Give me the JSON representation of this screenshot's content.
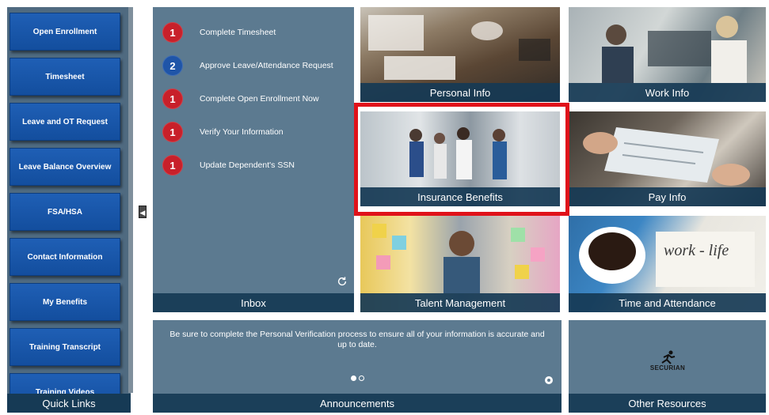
{
  "sidebar": {
    "items": [
      {
        "label": "Open Enrollment"
      },
      {
        "label": "Timesheet"
      },
      {
        "label": "Leave and OT Request"
      },
      {
        "label": "Leave Balance Overview"
      },
      {
        "label": "FSA/HSA"
      },
      {
        "label": "Contact Information"
      },
      {
        "label": "My Benefits"
      },
      {
        "label": "Training Transcript"
      },
      {
        "label": "Training Videos"
      }
    ],
    "footer": "Quick Links"
  },
  "inbox": {
    "items": [
      {
        "count": "1",
        "text": "Complete Timesheet",
        "color": "#c8202a"
      },
      {
        "count": "2",
        "text": "Approve Leave/Attendance Request",
        "color": "#1f55a8"
      },
      {
        "count": "1",
        "text": "Complete Open Enrollment Now",
        "color": "#c8202a"
      },
      {
        "count": "1",
        "text": "Verify Your Information",
        "color": "#c8202a"
      },
      {
        "count": "1",
        "text": "Update Dependent's SSN",
        "color": "#c8202a"
      }
    ],
    "label": "Inbox"
  },
  "tiles": {
    "personal": "Personal Info",
    "work": "Work Info",
    "insurance": "Insurance Benefits",
    "pay": "Pay Info",
    "talent": "Talent Management",
    "time": "Time and Attendance"
  },
  "announcements": {
    "text": "Be sure to complete the Personal Verification process to ensure all of your information is accurate and up to date.",
    "label": "Announcements"
  },
  "other": {
    "logo_text": "SECURIAN",
    "label": "Other Resources"
  },
  "colors": {
    "highlight": "#e0121a",
    "tile_bg": "#5c7a90",
    "label_bar": "#163a55",
    "button_blue": "#1f5fb5"
  }
}
